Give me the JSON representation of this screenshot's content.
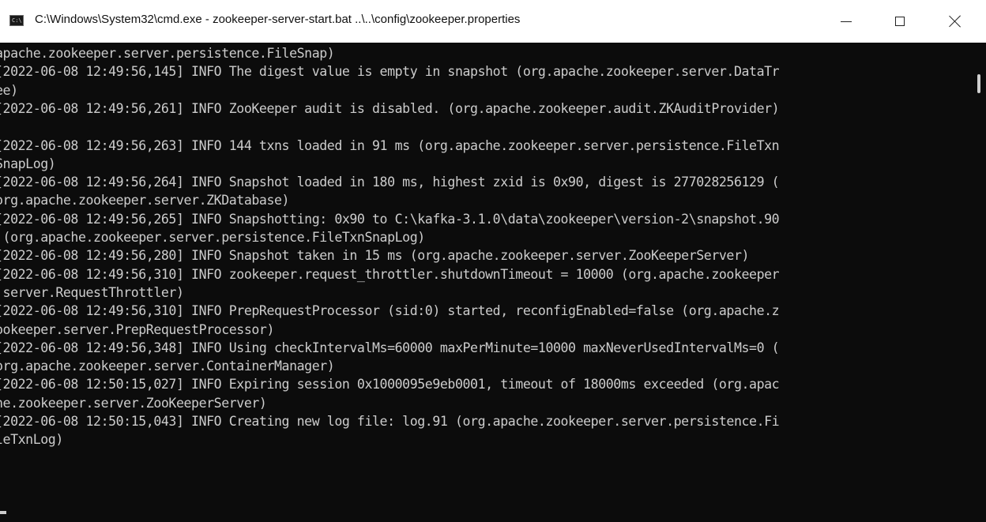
{
  "window": {
    "title": "C:\\Windows\\System32\\cmd.exe - zookeeper-server-start.bat  ..\\..\\config\\zookeeper.properties",
    "icon": "cmd-icon",
    "icon_text": "C:\\"
  },
  "controls": {
    "minimize": "minimize-icon",
    "maximize": "maximize-icon",
    "close": "close-icon"
  },
  "console": {
    "lines": [
      "apache.zookeeper.server.persistence.FileSnap)",
      "[2022-06-08 12:49:56,145] INFO The digest value is empty in snapshot (org.apache.zookeeper.server.DataTr",
      "ee)",
      "[2022-06-08 12:49:56,261] INFO ZooKeeper audit is disabled. (org.apache.zookeeper.audit.ZKAuditProvider)",
      "",
      "[2022-06-08 12:49:56,263] INFO 144 txns loaded in 91 ms (org.apache.zookeeper.server.persistence.FileTxn",
      "SnapLog)",
      "[2022-06-08 12:49:56,264] INFO Snapshot loaded in 180 ms, highest zxid is 0x90, digest is 277028256129 (",
      "org.apache.zookeeper.server.ZKDatabase)",
      "[2022-06-08 12:49:56,265] INFO Snapshotting: 0x90 to C:\\kafka-3.1.0\\data\\zookeeper\\version-2\\snapshot.90",
      " (org.apache.zookeeper.server.persistence.FileTxnSnapLog)",
      "[2022-06-08 12:49:56,280] INFO Snapshot taken in 15 ms (org.apache.zookeeper.server.ZooKeeperServer)",
      "[2022-06-08 12:49:56,310] INFO zookeeper.request_throttler.shutdownTimeout = 10000 (org.apache.zookeeper",
      ".server.RequestThrottler)",
      "[2022-06-08 12:49:56,310] INFO PrepRequestProcessor (sid:0) started, reconfigEnabled=false (org.apache.z",
      "ookeeper.server.PrepRequestProcessor)",
      "[2022-06-08 12:49:56,348] INFO Using checkIntervalMs=60000 maxPerMinute=10000 maxNeverUsedIntervalMs=0 (",
      "org.apache.zookeeper.server.ContainerManager)",
      "[2022-06-08 12:50:15,027] INFO Expiring session 0x1000095e9eb0001, timeout of 18000ms exceeded (org.apac",
      "he.zookeeper.server.ZooKeeperServer)",
      "[2022-06-08 12:50:15,043] INFO Creating new log file: log.91 (org.apache.zookeeper.server.persistence.Fi",
      "leTxnLog)",
      ""
    ]
  },
  "colors": {
    "console_bg": "#0c0c0c",
    "console_text": "#cccccc",
    "titlebar_bg": "#ffffff"
  }
}
